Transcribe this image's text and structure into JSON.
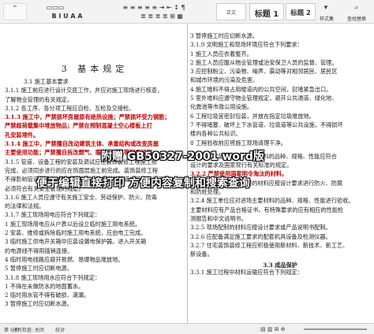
{
  "ribbon": {
    "style_normal": "正文",
    "style_h1": "标题 1",
    "style_h2": "标题 2",
    "styles_set": "样式集",
    "find_replace": "查找替换"
  },
  "overlay": {
    "top": "附赠 GB50327-2001 word版",
    "bottom": "便于编辑直接打印 方便内容复制和搜索查询"
  },
  "left": {
    "title": "3 基本规定",
    "section": "3.1 施工基本要求",
    "lines": [
      "3.1.1 施工前应进行设计交底工作，并应对施工现场进行核查，",
      "了解物业管理的有关规定。",
      "3.1.2 各工序、各分项工程应自检、互检及交接检。",
      "3.1.3 施工中，严禁损坏房屋原有绝热设施；严禁损坏受力钢筋；",
      "严禁超荷载集中堆放物品；严禁在预制混凝土空心楼板上打",
      "孔安装埋件。",
      "3.1.4 施工中，严禁擅自改动建筑主体、承重结构或改变房屋",
      "主要使用功能；严禁擅自拆改燃气、暖气、通讯等配套设施。",
      "3.1.5 管道、设备工程的安装及调试应在装饰装修工程施工前",
      "完成，必须同步进行的应在饰面层施工前完成。装饰装修工程",
      "不得影响管道、设备的使用和维修。涉及燃气管道的装饰装修工程",
      "必须符合有关安全管理的规定。",
      "3.1.6 施工人员应遵守有关施工安全、劳动保护、防火、防毒",
      "的法律和法规。",
      "3.1.7 施工现场用电应符合下列规定：",
      "1 施工现场用电应从户表以后设立临时施工用电系统。",
      "2 安装、维修或拆除临时施工用电系统，应由电工完成。",
      "3 临时施工供电开关箱中应装设漏电保护器。进入开关箱",
      "的电源线不得用插销连接。",
      "4 临时用电线路应避开易燃、易爆物品堆放地。",
      "5 暂停施工时应切断电源。",
      "3.1.8 施工现场用水应符合下列规定：",
      "1 不得在未做防水的地面蓄水。",
      "2 临时用水管不得有破损、滴漏。",
      "3 暂停施工时应切断水源。"
    ]
  },
  "right": {
    "lines_top": [
      "3 暂停施工时应切断水源。",
      "3.1.9 文明施工和现场环境应符合下列要求：",
      "1 施工人员应衣着整齐。",
      "2 施工人员应服从物业管理或治安保卫人员的监督、管理。",
      "3 应控制粉尘、污染物、噪声、震动等对相邻居民、居民区",
      "和城市环境的污染及危害。",
      "4 施工堆料不得占用楼道内的公共空间，封堵紧急出口。",
      "5 室外堆料应遵守物业管理规定，避开公共通道、绿化地、",
      "化粪池等市政公用设施。",
      "6 工程垃圾宜密封包装，并放在指定垃圾堆放地。",
      "7 不得堵塞、破坏上下水管道、垃圾道等公共设施，不得损坏",
      "楼内各种公共标识。",
      "8 工程验收前应将施工现场清理干净。"
    ],
    "lines_bottom": [
      "3.2.1 住宅装饰装修所用的材料的品种、规格、性能应符合",
      "设计的要求及国家现行有关标准的规定。",
      "3.2.2 严禁使用国家明令淘汰的材料。",
      "3.2.3 住宅装饰装修所用的材料应按设计要求进行防火、防腐",
      "和防蛀处理。",
      "3.2.4 施工单位应对进场主要材料的品种、规格、性能进行验收。",
      "主要材料应有产品合格证书，有特殊要求的应有相应的性能检",
      "测报告和中文说明书。",
      "3.2.5 现场配制的材料应按设计要求或产品说明书配制。",
      "3.2.6 应配备满足施工要求的配套机具设备及检测仪器。",
      "3.2.7 住宅装饰装修工程应积极使用新材料、新技术、新工艺、",
      "新设备。"
    ],
    "section": "3.3 成品保护",
    "last": "3.3.1 施工过程中材料运输应符合下列规定："
  },
  "status": {
    "page": "第 5 页",
    "spell": "拼写检查: 关闭",
    "proof": "校对"
  }
}
